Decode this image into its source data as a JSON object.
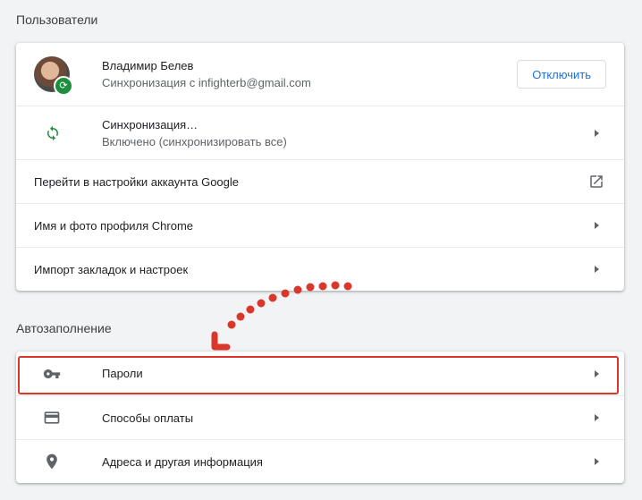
{
  "users_section": {
    "title": "Пользователи",
    "account": {
      "name": "Владимир Белев",
      "sync_email": "Синхронизация с infighterb@gmail.com",
      "disconnect_button": "Отключить"
    },
    "sync": {
      "title": "Синхронизация…",
      "status": "Включено (синхронизировать все)"
    },
    "items": [
      "Перейти в настройки аккаунта Google",
      "Имя и фото профиля Chrome",
      "Импорт закладок и настроек"
    ]
  },
  "autofill_section": {
    "title": "Автозаполнение",
    "items": [
      {
        "label": "Пароли",
        "icon": "key-icon"
      },
      {
        "label": "Способы оплаты",
        "icon": "credit-card-icon"
      },
      {
        "label": "Адреса и другая информация",
        "icon": "location-pin-icon"
      }
    ]
  },
  "colors": {
    "accent": "#1a73e8",
    "sync_green": "#1e8e3e",
    "annotation_red": "#d9372b"
  }
}
